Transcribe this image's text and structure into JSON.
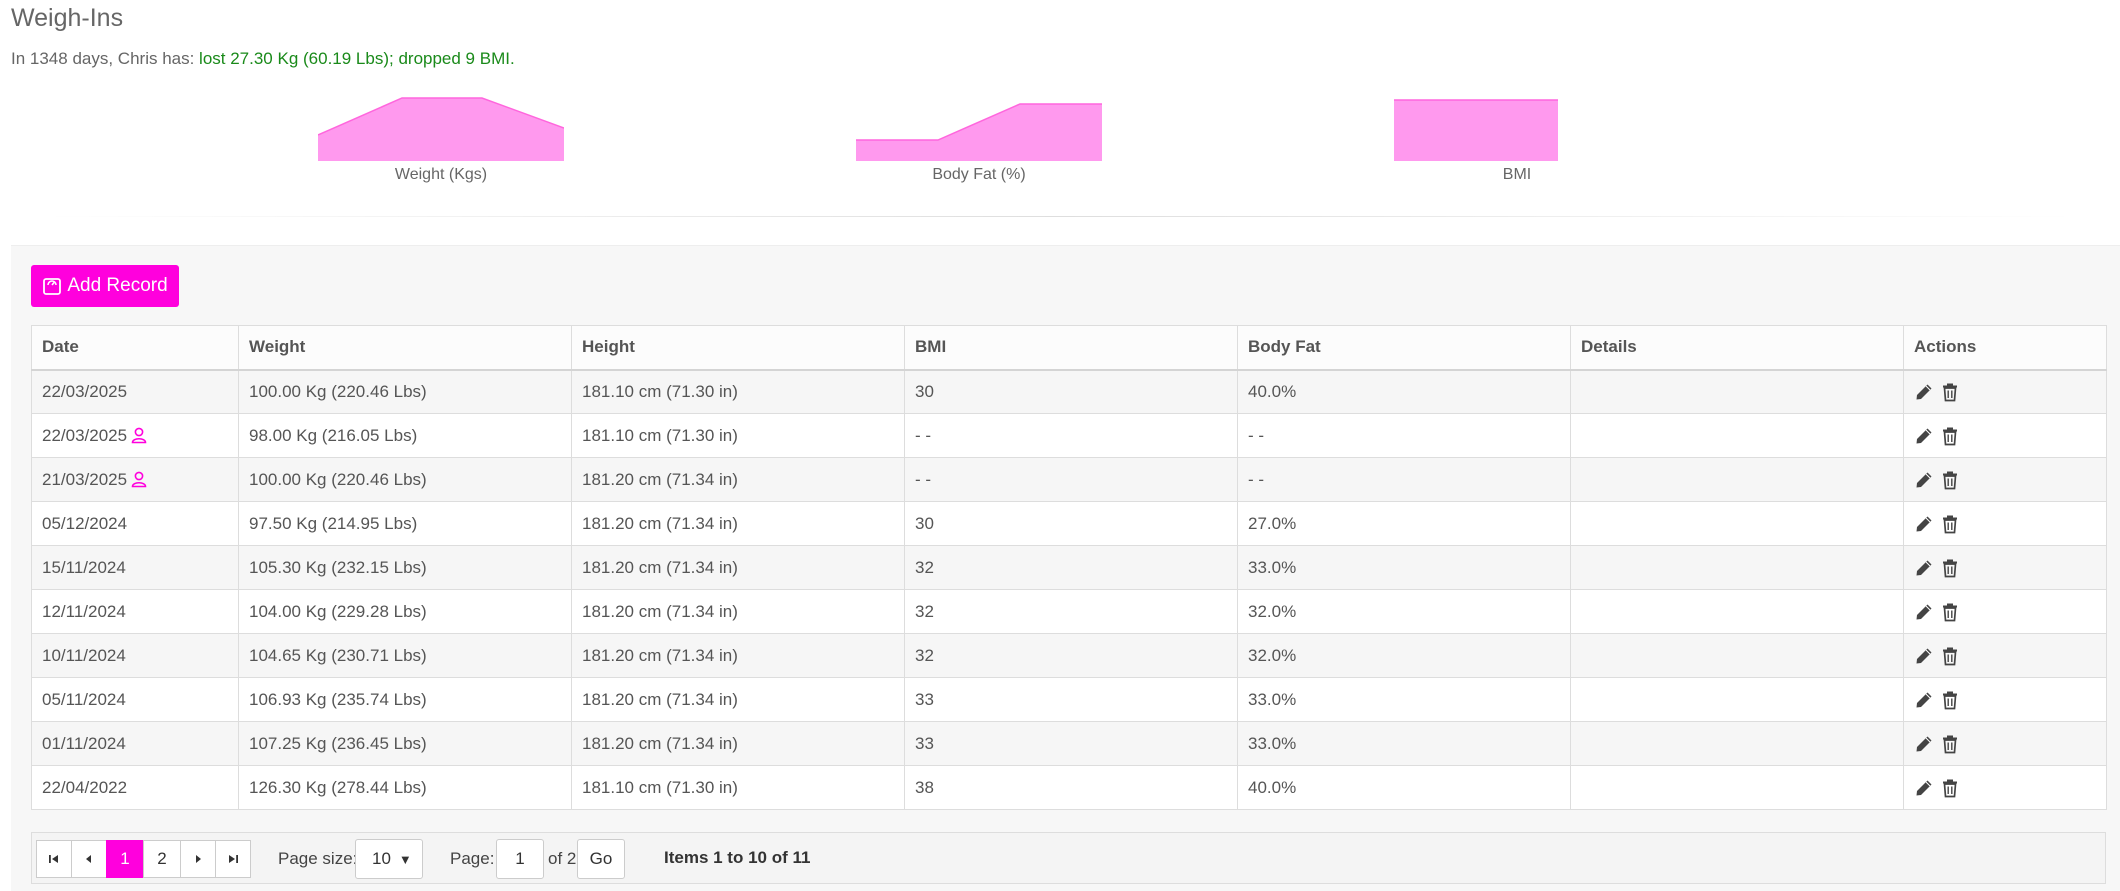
{
  "header": {
    "title": "Weigh-Ins",
    "summary_prefix": "In 1348 days, Chris has: ",
    "summary_highlight": "lost 27.30 Kg (60.19 Lbs); dropped 9 BMI."
  },
  "sparklines": [
    {
      "label": "Weight (Kgs)",
      "fill": "#ff99ee",
      "stroke": "#ff66dd"
    },
    {
      "label": "Body Fat (%)",
      "fill": "#ff99ee",
      "stroke": "#ff66dd"
    },
    {
      "label": "BMI",
      "fill": "#ff99ee",
      "stroke": "#ff66dd"
    }
  ],
  "toolbar": {
    "add_label": "Add Record",
    "add_icon": "scale-icon"
  },
  "table": {
    "columns": [
      "Date",
      "Weight",
      "Height",
      "BMI",
      "Body Fat",
      "Details",
      "Actions"
    ],
    "rows": [
      {
        "date": "22/03/2025",
        "user_icon": false,
        "weight": "100.00 Kg (220.46 Lbs)",
        "height": "181.10 cm (71.30 in)",
        "bmi": "30",
        "body_fat": "40.0%",
        "details": ""
      },
      {
        "date": "22/03/2025",
        "user_icon": true,
        "weight": "98.00 Kg (216.05 Lbs)",
        "height": "181.10 cm (71.30 in)",
        "bmi": "- -",
        "body_fat": "- -",
        "details": ""
      },
      {
        "date": "21/03/2025",
        "user_icon": true,
        "weight": "100.00 Kg (220.46 Lbs)",
        "height": "181.20 cm (71.34 in)",
        "bmi": "- -",
        "body_fat": "- -",
        "details": ""
      },
      {
        "date": "05/12/2024",
        "user_icon": false,
        "weight": "97.50 Kg (214.95 Lbs)",
        "height": "181.20 cm (71.34 in)",
        "bmi": "30",
        "body_fat": "27.0%",
        "details": ""
      },
      {
        "date": "15/11/2024",
        "user_icon": false,
        "weight": "105.30 Kg (232.15 Lbs)",
        "height": "181.20 cm (71.34 in)",
        "bmi": "32",
        "body_fat": "33.0%",
        "details": ""
      },
      {
        "date": "12/11/2024",
        "user_icon": false,
        "weight": "104.00 Kg (229.28 Lbs)",
        "height": "181.20 cm (71.34 in)",
        "bmi": "32",
        "body_fat": "32.0%",
        "details": ""
      },
      {
        "date": "10/11/2024",
        "user_icon": false,
        "weight": "104.65 Kg (230.71 Lbs)",
        "height": "181.20 cm (71.34 in)",
        "bmi": "32",
        "body_fat": "32.0%",
        "details": ""
      },
      {
        "date": "05/11/2024",
        "user_icon": false,
        "weight": "106.93 Kg (235.74 Lbs)",
        "height": "181.20 cm (71.34 in)",
        "bmi": "33",
        "body_fat": "33.0%",
        "details": ""
      },
      {
        "date": "01/11/2024",
        "user_icon": false,
        "weight": "107.25 Kg (236.45 Lbs)",
        "height": "181.20 cm (71.34 in)",
        "bmi": "33",
        "body_fat": "33.0%",
        "details": ""
      },
      {
        "date": "22/04/2022",
        "user_icon": false,
        "weight": "126.30 Kg (278.44 Lbs)",
        "height": "181.10 cm (71.30 in)",
        "bmi": "38",
        "body_fat": "40.0%",
        "details": ""
      }
    ],
    "row_actions": [
      "edit-icon",
      "delete-icon"
    ]
  },
  "pager": {
    "pages": [
      "1",
      "2"
    ],
    "current_page": "1",
    "page_size_label": "Page size:",
    "page_size_value": "10",
    "page_label": "Page:",
    "page_input": "1",
    "of_label": "of 2",
    "go_label": "Go",
    "items_info": "Items 1 to 10 of 11"
  },
  "colors": {
    "accent": "#ff00dd",
    "positive": "#1a8a1a",
    "sparkline_fill": "#ff99ee"
  }
}
